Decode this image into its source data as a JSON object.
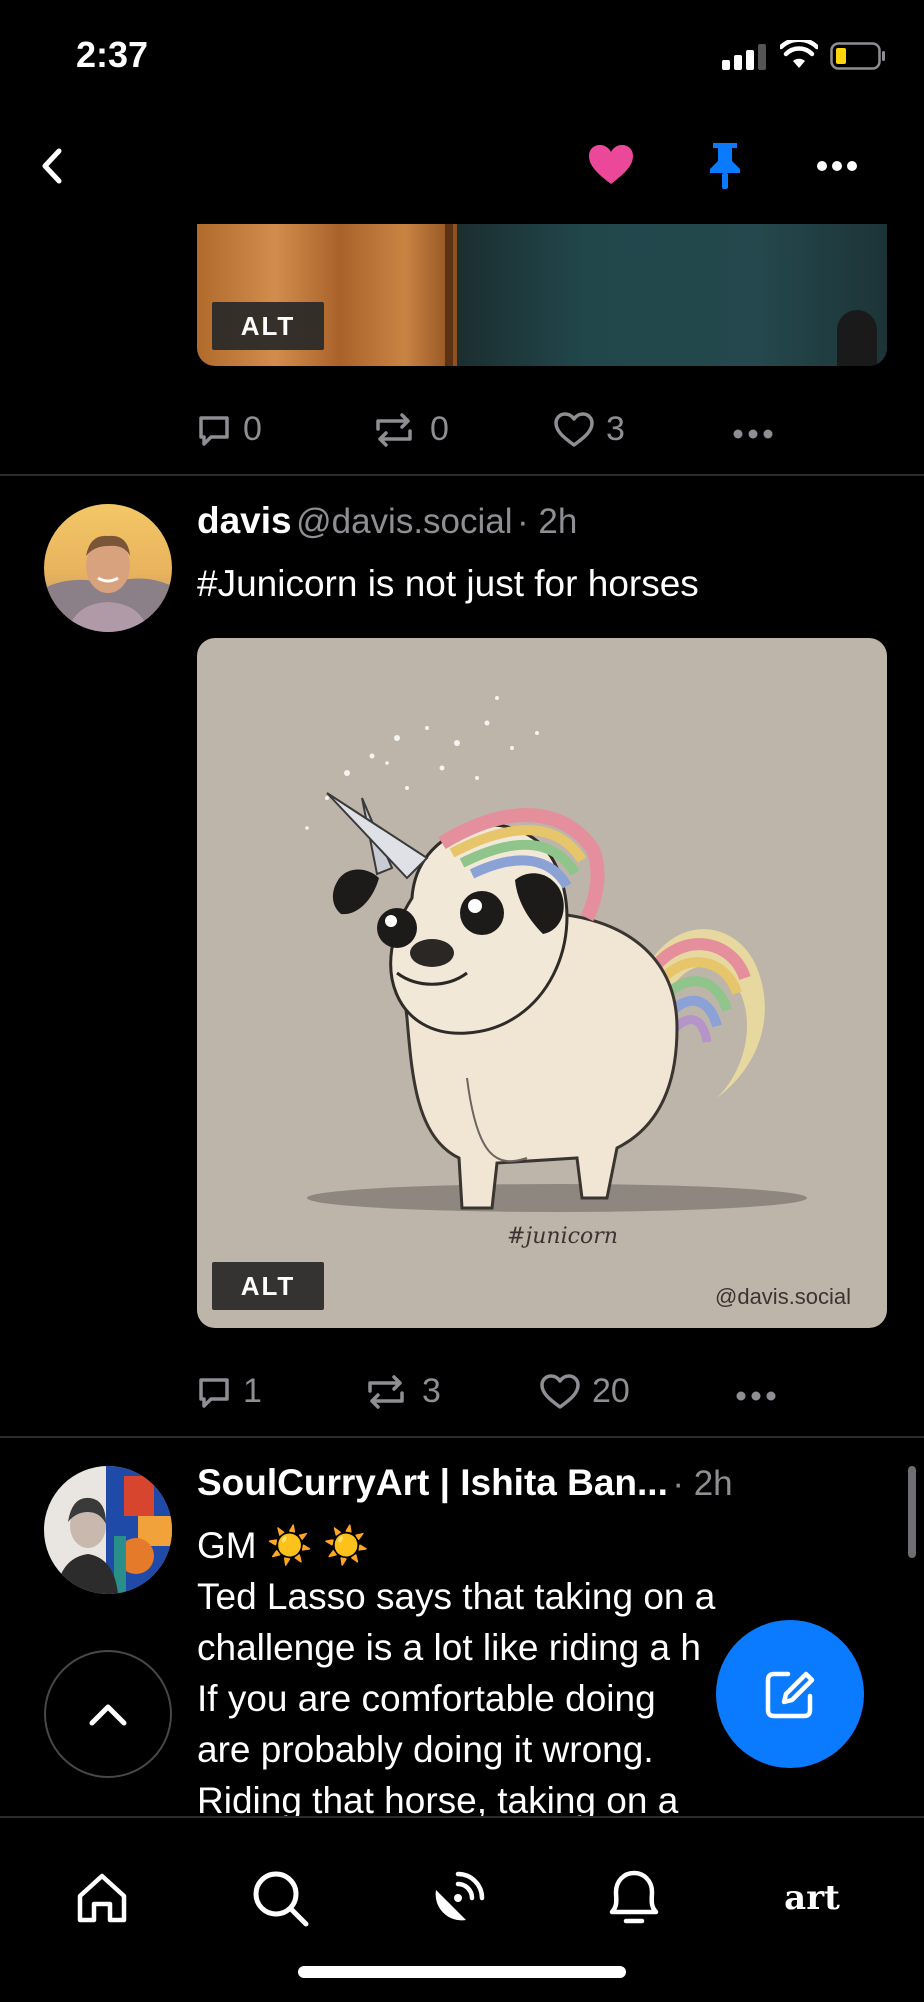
{
  "status": {
    "time": "2:37"
  },
  "header": {
    "back_icon": "chevron-left-icon",
    "heart_color": "#ec4899",
    "pin_color": "#0a7aff"
  },
  "post1": {
    "image_alt_label": "ALT",
    "actions": {
      "replies": "0",
      "reposts": "0",
      "likes": "3"
    }
  },
  "post2": {
    "author_name": "davis",
    "author_handle": "@davis.social",
    "time": "· 2h",
    "text": "#Junicorn is not just for horses",
    "image_alt_label": "ALT",
    "image_caption": "#junicorn",
    "image_watermark": "@davis.social",
    "actions": {
      "replies": "1",
      "reposts": "3",
      "likes": "20"
    }
  },
  "post3": {
    "author_name": "SoulCurryArt | Ishita Ban...",
    "time": "· 2h",
    "lines": [
      "GM ☀️ ☀️",
      "Ted Lasso says that taking on a",
      "challenge is a lot like riding a h",
      "If you are comfortable doing",
      "are probably doing it wrong.",
      "Riding that horse, taking on a"
    ]
  },
  "fab": {
    "color": "#0a7aff"
  },
  "tabbar": {
    "feeds_label": "art"
  }
}
